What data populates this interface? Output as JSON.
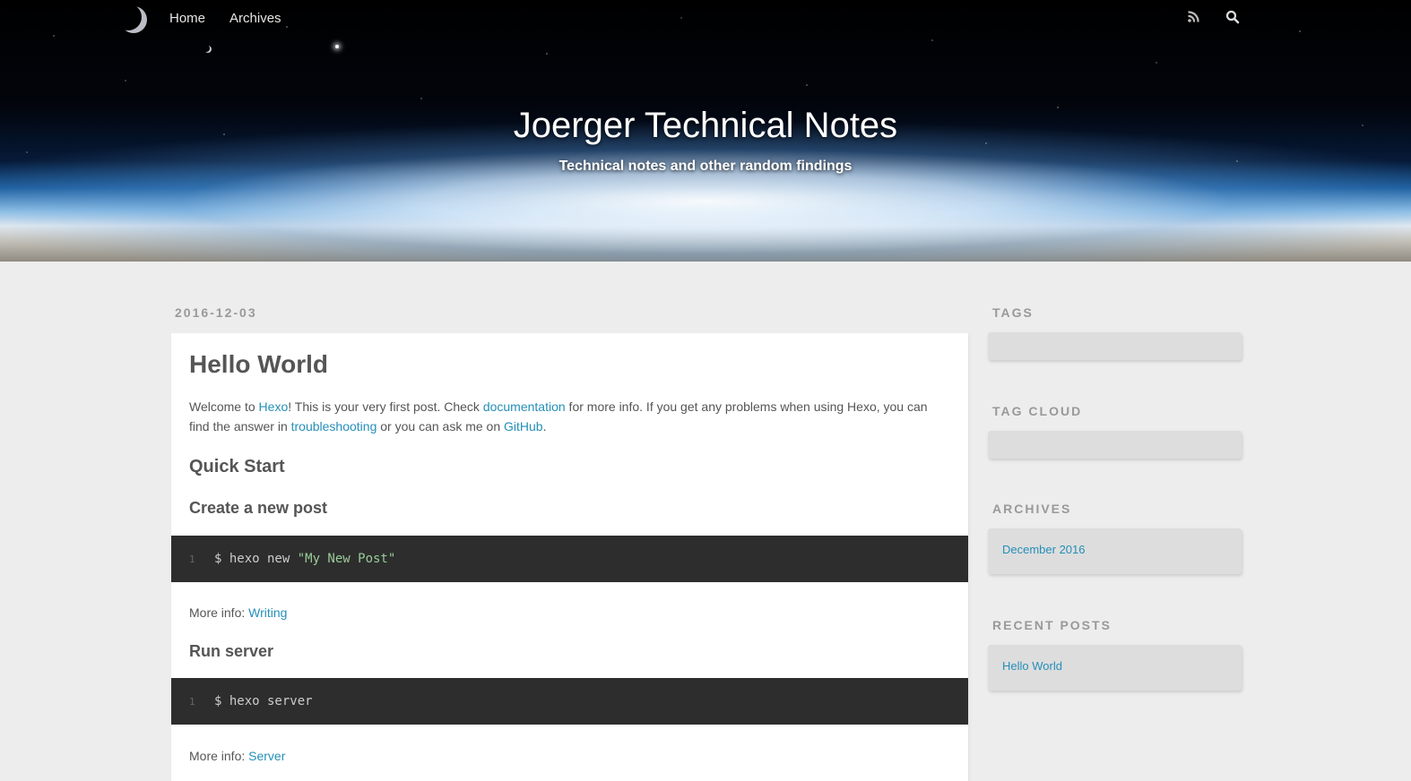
{
  "header": {
    "nav": [
      {
        "label": "Home"
      },
      {
        "label": "Archives"
      }
    ],
    "icons": [
      "rss-icon",
      "search-icon"
    ],
    "title": "Joerger Technical Notes",
    "subtitle": "Technical notes and other random findings"
  },
  "article": {
    "date": "2016-12-03",
    "title": "Hello World",
    "intro": {
      "p1": "Welcome to ",
      "hexo": "Hexo",
      "p2": "! This is your very first post. Check ",
      "documentation": "documentation",
      "p3": " for more info. If you get any problems when using Hexo, you can find the answer in ",
      "troubleshooting": "troubleshooting",
      "p4": " or you can ask me on ",
      "github": "GitHub",
      "p5": "."
    },
    "quick_start": "Quick Start",
    "create_post": "Create a new post",
    "code1": {
      "line": "1",
      "cmd": "$ hexo new ",
      "str": "\"My New Post\""
    },
    "more_info_label": "More info: ",
    "writing_link": "Writing",
    "run_server": "Run server",
    "code2": {
      "line": "1",
      "cmd": "$ hexo server"
    },
    "server_link": "Server"
  },
  "sidebar": {
    "tags_title": "TAGS",
    "tag_cloud_title": "TAG CLOUD",
    "archives_title": "ARCHIVES",
    "archives_item": "December 2016",
    "recent_title": "RECENT POSTS",
    "recent_item": "Hello World"
  },
  "colors": {
    "link": "#258fb8",
    "background": "#ededed",
    "code_bg": "#2d2d2d",
    "code_string": "#99cc99"
  }
}
